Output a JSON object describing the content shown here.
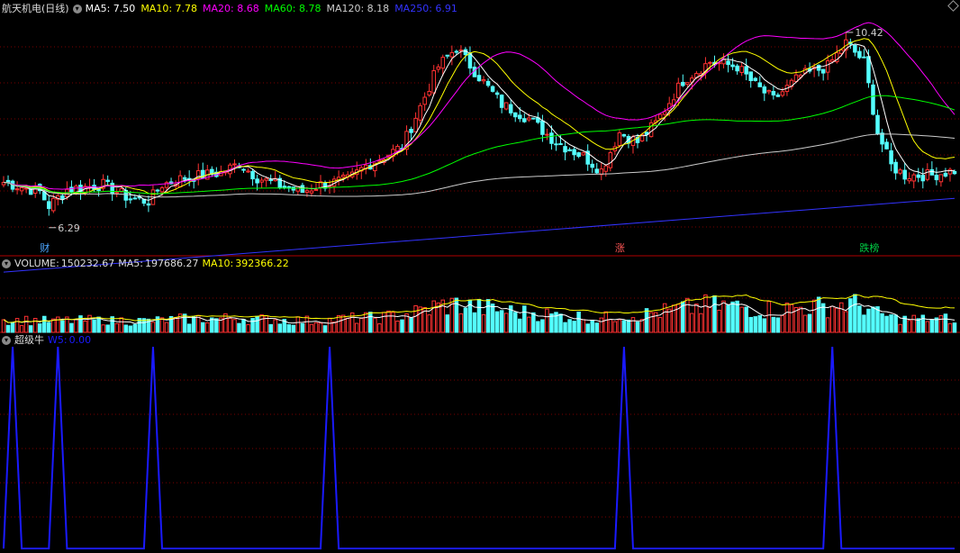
{
  "header": {
    "title": "航天机电(日线)",
    "indicators": [
      {
        "label": "MA5:",
        "value": "7.50",
        "color": "#ffffff"
      },
      {
        "label": "MA10:",
        "value": "7.78",
        "color": "#ffff00"
      },
      {
        "label": "MA20:",
        "value": "8.68",
        "color": "#ff00ff"
      },
      {
        "label": "MA60:",
        "value": "8.78",
        "color": "#00ff00"
      },
      {
        "label": "MA120:",
        "value": "8.18",
        "color": "#cccccc"
      },
      {
        "label": "MA250:",
        "value": "6.91",
        "color": "#3333ff"
      }
    ]
  },
  "volume_header": {
    "label": "VOLUME:",
    "value": "150232.67",
    "ma5_label": "MA5:",
    "ma5_value": "197686.27",
    "ma10_label": "MA10:",
    "ma10_value": "392366.22"
  },
  "indicator_header": {
    "name": "超级牛",
    "label": "W5:",
    "value": "0.00"
  },
  "events": [
    {
      "text": "财",
      "color": "#4da6ff",
      "index": 9
    },
    {
      "text": "涨",
      "color": "#ff5555",
      "index": 136
    },
    {
      "text": "跌榜",
      "color": "#00cc44",
      "index": 190
    }
  ],
  "colors": {
    "up": "#ff3232",
    "down": "#54ffff",
    "grid": "#7a0000",
    "panel_border": "#b00000",
    "signal": "#1a1aff"
  },
  "chart_data": {
    "type": "candlestick",
    "price_range": [
      6.0,
      10.8
    ],
    "annotations": [
      {
        "text": "6.29",
        "index": 10,
        "value": 6.29
      },
      {
        "text": "10.42",
        "index": 186,
        "value": 10.42
      }
    ],
    "moving_averages": [
      {
        "name": "MA5",
        "value": 7.5
      },
      {
        "name": "MA10",
        "value": 7.78
      },
      {
        "name": "MA20",
        "value": 8.68
      },
      {
        "name": "MA60",
        "value": 8.78
      },
      {
        "name": "MA120",
        "value": 8.18
      },
      {
        "name": "MA250",
        "value": 6.91
      }
    ],
    "price_keypoints": [
      [
        0,
        7.25
      ],
      [
        8,
        7.05
      ],
      [
        10,
        6.75
      ],
      [
        14,
        7.1
      ],
      [
        22,
        7.2
      ],
      [
        28,
        6.9
      ],
      [
        32,
        6.85
      ],
      [
        35,
        7.2
      ],
      [
        40,
        7.35
      ],
      [
        48,
        7.45
      ],
      [
        52,
        7.65
      ],
      [
        56,
        7.35
      ],
      [
        62,
        7.15
      ],
      [
        66,
        7.05
      ],
      [
        70,
        7.2
      ],
      [
        76,
        7.3
      ],
      [
        80,
        7.6
      ],
      [
        88,
        8.0
      ],
      [
        96,
        9.7
      ],
      [
        100,
        10.1
      ],
      [
        104,
        9.6
      ],
      [
        110,
        8.9
      ],
      [
        116,
        8.6
      ],
      [
        122,
        8.1
      ],
      [
        128,
        7.8
      ],
      [
        132,
        7.5
      ],
      [
        136,
        8.3
      ],
      [
        140,
        8.1
      ],
      [
        144,
        8.5
      ],
      [
        150,
        9.4
      ],
      [
        156,
        9.8
      ],
      [
        162,
        9.7
      ],
      [
        166,
        9.3
      ],
      [
        170,
        9.0
      ],
      [
        176,
        9.5
      ],
      [
        182,
        9.7
      ],
      [
        186,
        10.2
      ],
      [
        190,
        9.8
      ],
      [
        193,
        8.3
      ],
      [
        196,
        7.6
      ],
      [
        199,
        7.4
      ],
      [
        205,
        7.4
      ],
      [
        210,
        7.5
      ]
    ],
    "volume_range": [
      0,
      1000000
    ],
    "volume_last": 150232.67,
    "volume_ma5": 197686.27,
    "volume_ma10": 392366.22,
    "signal_peaks": [
      2,
      12,
      33,
      72,
      137,
      183
    ],
    "signal_range": [
      0,
      1
    ],
    "bar_count": 211
  }
}
